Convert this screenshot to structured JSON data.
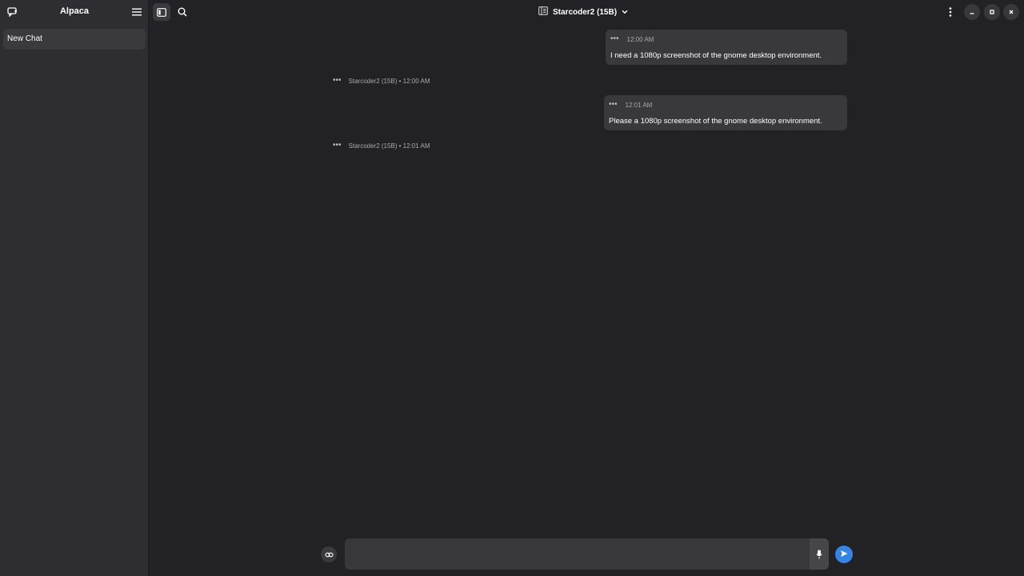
{
  "sidebar": {
    "title": "Alpaca",
    "chats": [
      {
        "label": "New Chat"
      }
    ]
  },
  "header": {
    "model": "Starcoder2 (15B)"
  },
  "messages": [
    {
      "role": "user",
      "time": "12:00 AM",
      "text": "I need a 1080p screenshot of the gnome desktop environment."
    },
    {
      "role": "bot",
      "info": "Starcoder2 (15B) • 12:00 AM"
    },
    {
      "role": "user",
      "time": "12:01 AM",
      "text": "Please a 1080p screenshot of the gnome desktop environment."
    },
    {
      "role": "bot",
      "info": "Starcoder2 (15B) • 12:01 AM"
    }
  ],
  "input": {
    "value": "",
    "placeholder": ""
  },
  "colors": {
    "accent": "#3584e4",
    "sidebar_bg": "#2e2e32",
    "main_bg": "#222226"
  }
}
